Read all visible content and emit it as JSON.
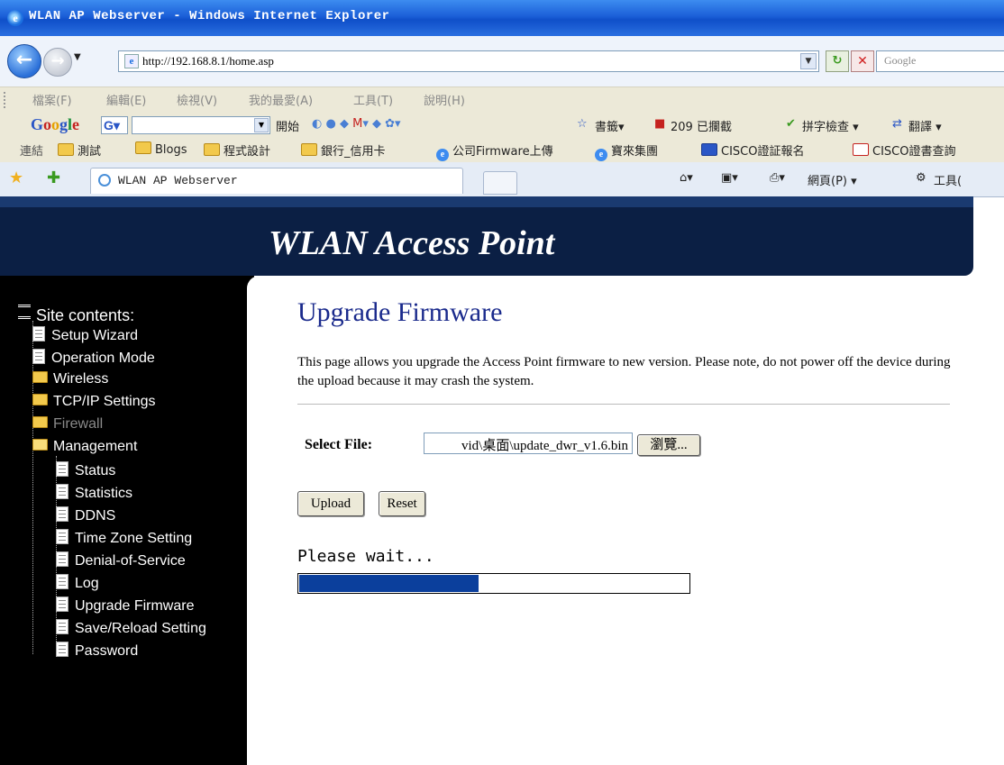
{
  "window": {
    "title": "WLAN AP Webserver - Windows Internet Explorer"
  },
  "address": {
    "url": "http://192.168.8.1/home.asp"
  },
  "search": {
    "placeholder": "Google"
  },
  "menu": [
    "檔案(F)",
    "編輯(E)",
    "檢視(V)",
    "我的最愛(A)",
    "工具(T)",
    "說明(H)"
  ],
  "google_toolbar": {
    "logo": "Google",
    "go_label": "開始",
    "bookmarks_label": "書籤▾",
    "blocked_label": "209 已攔截",
    "spellcheck_label": "拼字檢查 ▾",
    "translate_label": "翻譯 ▾"
  },
  "links_bar": {
    "label": "連結",
    "items": [
      "測試",
      "Blogs",
      "程式設計",
      "銀行_信用卡",
      "公司Firmware上傳",
      "寶來集團",
      "CISCO證証報名",
      "CISCO證書查詢"
    ]
  },
  "tabs": {
    "active_label": "WLAN AP Webserver"
  },
  "command_bar": {
    "page_label": "網頁(P) ▾",
    "tools_label": "工具("
  },
  "banner": {
    "title": "WLAN Access Point"
  },
  "sidebar": {
    "header": "Site contents:",
    "items": [
      {
        "label": "Setup Wizard"
      },
      {
        "label": "Operation Mode"
      },
      {
        "label": "Wireless"
      },
      {
        "label": "TCP/IP Settings"
      },
      {
        "label": "Firewall"
      },
      {
        "label": "Management"
      },
      {
        "label": "Status"
      },
      {
        "label": "Statistics"
      },
      {
        "label": "DDNS"
      },
      {
        "label": "Time Zone Setting"
      },
      {
        "label": "Denial-of-Service"
      },
      {
        "label": "Log"
      },
      {
        "label": "Upgrade Firmware"
      },
      {
        "label": "Save/Reload Setting"
      },
      {
        "label": "Password"
      }
    ]
  },
  "main": {
    "title": "Upgrade Firmware",
    "description": "This page allows you upgrade the Access Point firmware to new version. Please note, do not power off the device during the upload because it may crash the system.",
    "select_file_label": "Select File:",
    "file_value": "vid\\桌面\\update_dwr_v1.6.bin",
    "browse_label": "瀏覽...",
    "upload_label": "Upload",
    "reset_label": "Reset",
    "wait_text": "Please wait...",
    "progress": 0.46
  },
  "colors": {
    "banner_bg": "#0b1f44",
    "title_blue": "#1a2a8c",
    "progress_fill": "#0b3f9c"
  }
}
